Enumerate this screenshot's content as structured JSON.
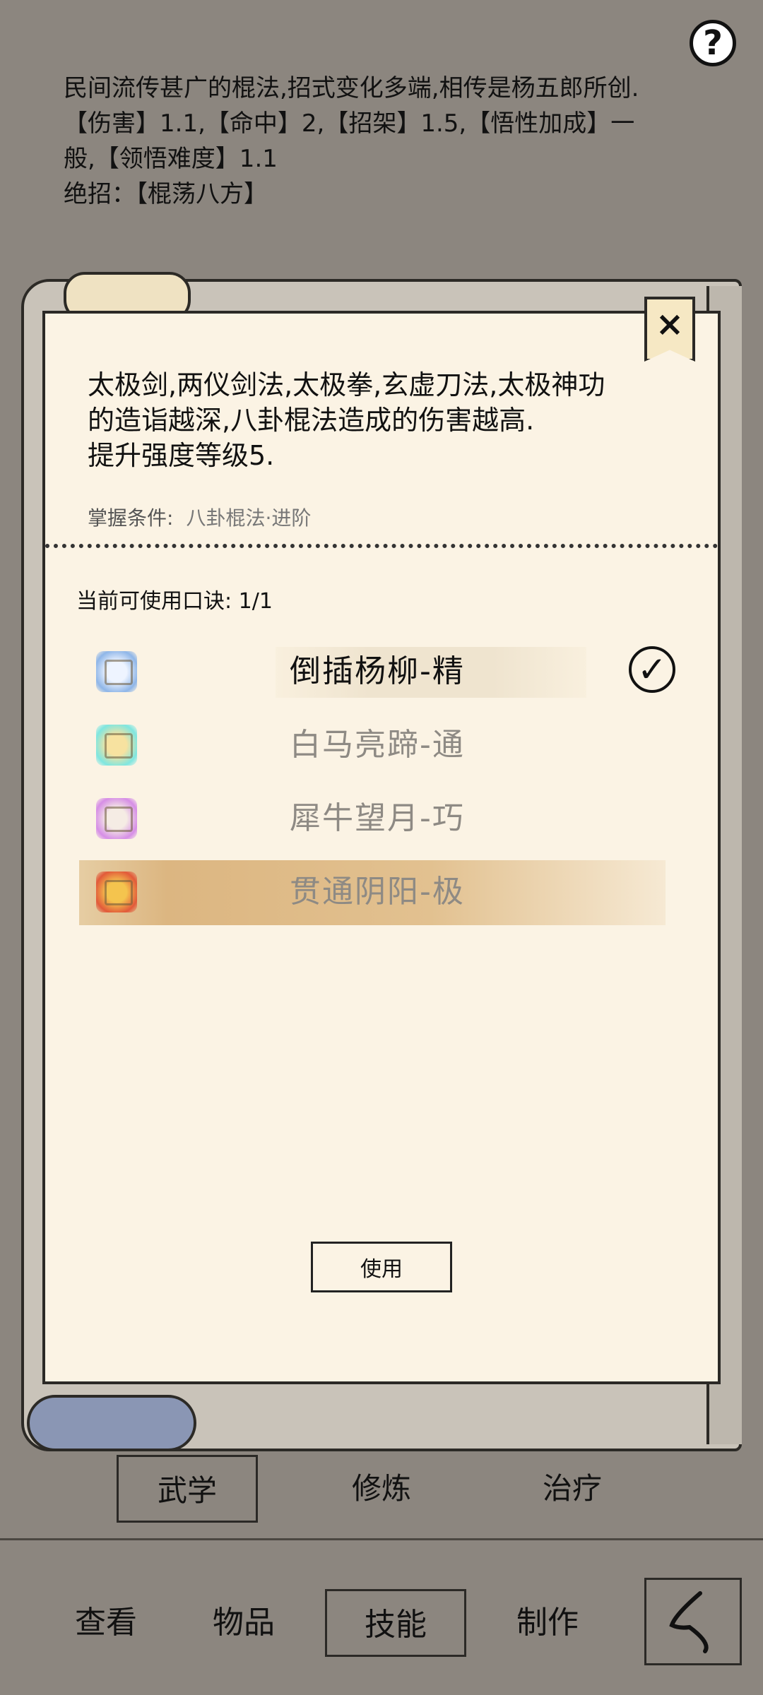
{
  "header": {
    "help_label": "?",
    "description": [
      "民间流传甚广的棍法,招式变化多端,相传是杨五郎所创.",
      "【伤害】1.1,【命中】2,【招架】1.5,【悟性加成】一",
      "般,【领悟难度】1.1",
      "绝招：【棍荡八方】"
    ]
  },
  "dialog": {
    "close_label": "×",
    "skill_text": [
      "太极剑,两仪剑法,太极拳,玄虚刀法,太极神功",
      "的造诣越深,八卦棍法造成的伤害越高.",
      "提升强度等级5."
    ],
    "mastery_label": "掌握条件:",
    "mastery_value": "八卦棍法·进阶",
    "count_text": "当前可使用口诀:  1/1",
    "mantras": [
      {
        "name": "倒插杨柳-精",
        "icon": "scroll-blue-icon",
        "color": "#8fb6e8"
      },
      {
        "name": "白马亮蹄-通",
        "icon": "scroll-cyan-icon",
        "color": "#7fe6e0"
      },
      {
        "name": "犀牛望月-巧",
        "icon": "scroll-purple-icon",
        "color": "#d68ee6"
      },
      {
        "name": "贯通阴阳-极",
        "icon": "scroll-red-icon",
        "color": "#e25a3a"
      }
    ],
    "check_label": "✓",
    "use_label": "使用"
  },
  "subtabs": [
    "武学",
    "修炼",
    "治疗"
  ],
  "nav": [
    "查看",
    "物品",
    "技能",
    "制作"
  ],
  "colors": {
    "background": "#8c867f",
    "panel": "#fbf3e4",
    "highlight": "#dcb681"
  }
}
